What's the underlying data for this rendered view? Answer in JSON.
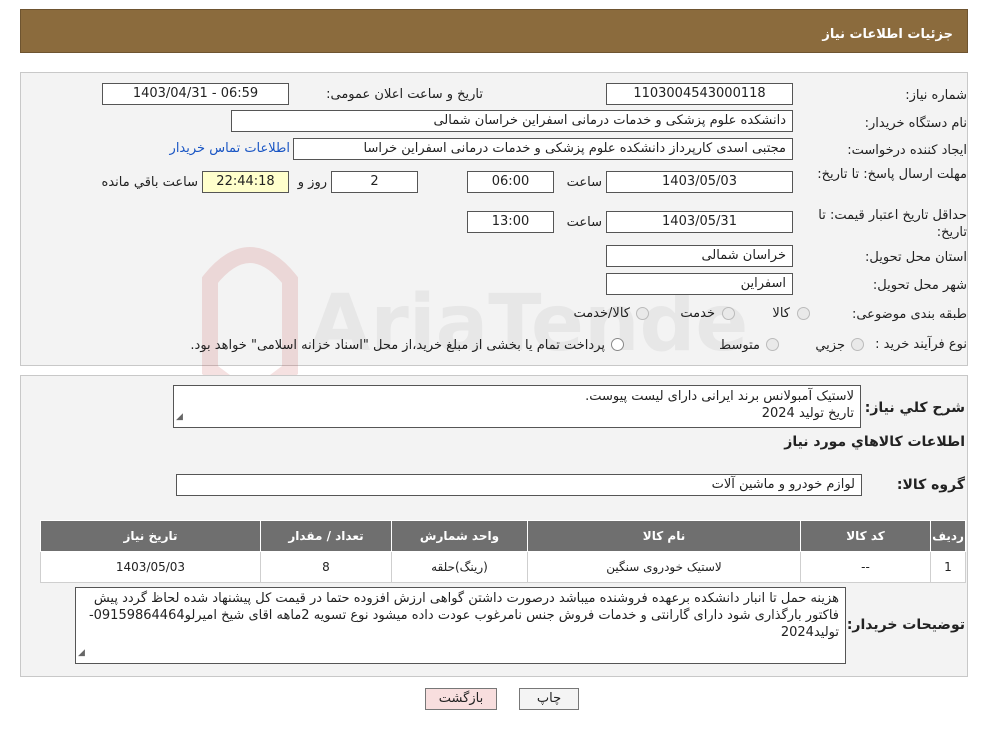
{
  "header": {
    "title": "جزئیات اطلاعات نیاز"
  },
  "form": {
    "need_number_label": "شماره نیاز:",
    "need_number": "1103004543000118",
    "announce_label": "تاریخ و ساعت اعلان عمومی:",
    "announce_value": "1403/04/31 - 06:59",
    "buyer_org_label": "نام دستگاه خریدار:",
    "buyer_org": "دانشکده علوم پزشکی و خدمات درمانی اسفراین خراسان شمالی",
    "requester_label": "ایجاد کننده درخواست:",
    "requester": "مجتبی اسدی کارپرداز  دانشکده علوم پزشکی و خدمات درمانی اسفراین خراسا",
    "contact_link": "اطلاعات تماس خریدار",
    "deadline_label": "مهلت ارسال پاسخ: تا تاریخ:",
    "deadline_date": "1403/05/03",
    "time_label": "ساعت",
    "deadline_time": "06:00",
    "days_value": "2",
    "days_label": "روز و",
    "remaining_time": "22:44:18",
    "remaining_label": "ساعت باقي مانده",
    "validity_label": "حداقل تاریخ اعتبار قیمت: تا تاریخ:",
    "validity_date": "1403/05/31",
    "validity_time": "13:00",
    "province_label": "استان محل تحویل:",
    "province": "خراسان شمالی",
    "city_label": "شهر محل تحویل:",
    "city": "اسفراین",
    "category_label": "طبقه بندی موضوعی:",
    "category_options": [
      "کالا",
      "خدمت",
      "کالا/خدمت"
    ],
    "purchase_type_label": "نوع فرآیند خرید :",
    "purchase_options": [
      "جزيي",
      "متوسط"
    ],
    "purchase_note": "پرداخت تمام یا بخشی از مبلغ خرید،از محل \"اسناد خزانه اسلامی\" خواهد بود."
  },
  "details": {
    "summary_label": "شرح كلي نياز:",
    "summary_line1": "لاستیک آمبولانس برند ایرانی دارای لیست پیوست.",
    "summary_line2": "تاریخ تولید 2024",
    "goods_info_title": "اطلاعات كالاهاي مورد نياز",
    "group_label": "گروه کالا:",
    "group_value": "لوازم خودرو و ماشین آلات",
    "table": {
      "headers": [
        "رديف",
        "کد کالا",
        "نام کالا",
        "واحد شمارش",
        "تعداد / مقدار",
        "تاریخ نیاز"
      ],
      "rows": [
        [
          "1",
          "--",
          "لاستیک خودروی سنگین",
          "(رینگ)حلقه",
          "8",
          "1403/05/03"
        ]
      ]
    },
    "buyer_notes_label": "توضیحات خریدار:",
    "buyer_notes": "هزینه حمل تا انبار دانشکده برعهده فروشنده میباشد درصورت داشتن گواهی ارزش افزوده حتما در قیمت کل پیشنهاد شده لحاظ گردد پیش فاکتور بارگذاری شود دارای گارانتی و خدمات فروش جنس نامرغوب عودت داده میشود نوع تسویه 2ماهه اقای شیخ امیرلو09159864464-تولید2024"
  },
  "buttons": {
    "print": "چاپ",
    "back": "بازگشت"
  },
  "watermark": {
    "text": "AriaTender.neT"
  },
  "colors": {
    "header": "#8b6b3d",
    "table_header": "#6f6f6f",
    "link": "#1a56c4",
    "back_button": "#f8dede"
  }
}
